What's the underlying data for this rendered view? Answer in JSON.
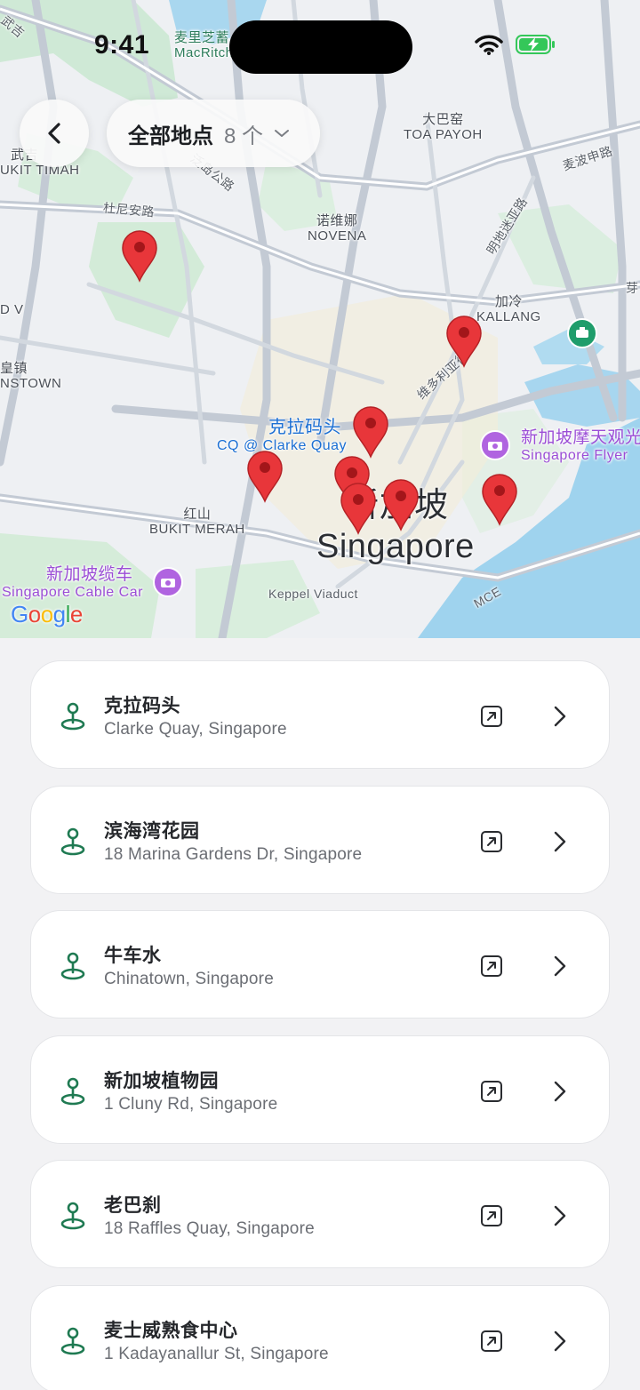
{
  "status_bar": {
    "time": "9:41"
  },
  "header": {
    "filter_title": "全部地点",
    "filter_count": "8 个"
  },
  "map": {
    "labels": {
      "macritchie_cn": "麦里芝蓄",
      "macritchie_en": "MacRitchie R",
      "toa_payoh_cn": "大巴窑",
      "toa_payoh_en": "TOA PAYOH",
      "bukit_timah_cn": "武吉",
      "bukit_timah_en": "UKIT TIMAH",
      "novena_cn": "诺维娜",
      "novena_en": "NOVENA",
      "kallang_cn": "加冷",
      "kallang_en": "KALLANG",
      "queenstown_cn": "皇镇",
      "queenstown_en": "NSTOWN",
      "dv": "D V",
      "bukit_merah_cn": "红山",
      "bukit_merah_en": "BUKIT MERAH",
      "clarke_quay_cn": "克拉码头",
      "clarke_quay_en": "CQ @ Clarke Quay",
      "flyer_cn": "新加坡摩天观光",
      "flyer_en": "Singapore Flyer",
      "cable_car_cn": "新加坡缆车",
      "cable_car_en": "Singapore Cable Car",
      "city_cn": "新加坡",
      "city_en": "Singapore",
      "keppel": "Keppel Viaduct",
      "mce": "MCE",
      "road_dunearn": "杜尼安路",
      "road_pan_island": "泛岛公路",
      "road_braddell": "麦波申路",
      "road_mingdi": "明地迷亚路",
      "road_victoria": "维多利亚街",
      "road_ya": "芽",
      "road_wuji": "武吉"
    },
    "google": [
      "G",
      "o",
      "o",
      "g",
      "l",
      "e"
    ],
    "google_colors": [
      "#4285F4",
      "#EA4335",
      "#FBBC05",
      "#4285F4",
      "#34A853",
      "#EA4335"
    ],
    "marker_count": 8,
    "marker_color": "#e8363a"
  },
  "locations": [
    {
      "name": "克拉码头",
      "address": "Clarke Quay, Singapore"
    },
    {
      "name": "滨海湾花园",
      "address": "18 Marina Gardens Dr, Singapore"
    },
    {
      "name": "牛车水",
      "address": "Chinatown, Singapore"
    },
    {
      "name": "新加坡植物园",
      "address": "1 Cluny Rd, Singapore"
    },
    {
      "name": "老巴刹",
      "address": "18 Raffles Quay, Singapore"
    },
    {
      "name": "麦士威熟食中心",
      "address": "1 Kadayanallur St, Singapore"
    }
  ],
  "icons": {
    "back": "chevron-left-icon",
    "dropdown": "chevron-down-icon",
    "pin": "map-pin-icon",
    "external": "open-external-icon",
    "row_chevron": "chevron-right-icon",
    "wifi": "wifi-icon",
    "battery": "battery-charging-icon"
  },
  "colors": {
    "accent_green": "#1f7a52",
    "marker_red": "#e8363a",
    "water": "#9fd3ee",
    "park": "#cfe9d6"
  }
}
